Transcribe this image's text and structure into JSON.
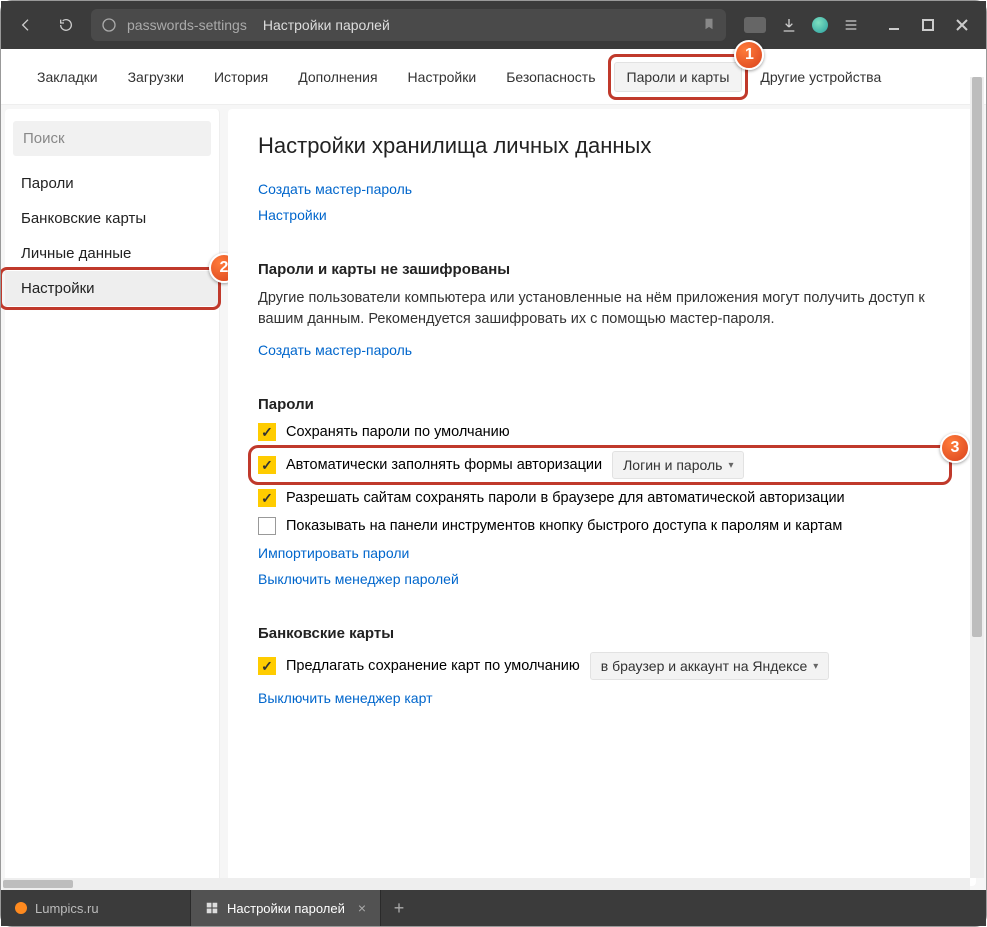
{
  "titlebar": {
    "url_slug": "passwords-settings",
    "page_title": "Настройки паролей"
  },
  "topnav": {
    "items": [
      "Закладки",
      "Загрузки",
      "История",
      "Дополнения",
      "Настройки",
      "Безопасность",
      "Пароли и карты",
      "Другие устройства"
    ],
    "active_index": 6
  },
  "sidebar": {
    "search_placeholder": "Поиск",
    "items": [
      "Пароли",
      "Банковские карты",
      "Личные данные",
      "Настройки"
    ],
    "active_index": 3
  },
  "main": {
    "heading": "Настройки хранилища личных данных",
    "top_links": [
      "Создать мастер-пароль",
      "Настройки"
    ],
    "encryption": {
      "title": "Пароли и карты не зашифрованы",
      "text": "Другие пользователи компьютера или установленные на нём приложения могут получить доступ к вашим данным. Рекомендуется зашифровать их с помощью мастер-пароля.",
      "link": "Создать мастер-пароль"
    },
    "passwords": {
      "title": "Пароли",
      "opts": [
        {
          "label": "Сохранять пароли по умолчанию",
          "checked": true
        },
        {
          "label": "Автоматически заполнять формы авторизации",
          "checked": true,
          "dropdown": "Логин и пароль"
        },
        {
          "label": "Разрешать сайтам сохранять пароли в браузере для автоматической авторизации",
          "checked": true
        },
        {
          "label": "Показывать на панели инструментов кнопку быстрого доступа к паролям и картам",
          "checked": false
        }
      ],
      "links": [
        "Импортировать пароли",
        "Выключить менеджер паролей"
      ]
    },
    "cards": {
      "title": "Банковские карты",
      "opt": {
        "label": "Предлагать сохранение карт по умолчанию",
        "checked": true,
        "dropdown": "в браузер и аккаунт на Яндексе"
      },
      "link": "Выключить менеджер карт"
    }
  },
  "markers": {
    "m1": "1",
    "m2": "2",
    "m3": "3"
  },
  "tabs": {
    "items": [
      {
        "title": "Lumpics.ru",
        "favicon_color": "#ff8a1f"
      },
      {
        "title": "Настройки паролей",
        "favicon_color": "#ffffff"
      }
    ],
    "active_index": 1
  }
}
